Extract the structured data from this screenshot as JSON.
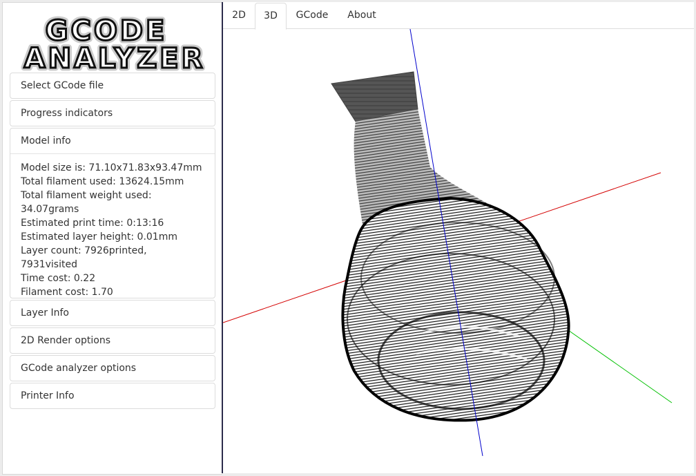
{
  "logo": {
    "line1": "GCODE",
    "line2": "ANALYZER"
  },
  "sidebar": {
    "items": [
      {
        "label": "Select GCode file"
      },
      {
        "label": "Progress indicators"
      },
      {
        "label": "Model info"
      },
      {
        "label": "Layer Info"
      },
      {
        "label": "2D Render options"
      },
      {
        "label": "GCode analyzer options"
      },
      {
        "label": "Printer Info"
      }
    ],
    "model_info": {
      "lines": [
        "Model size is: 71.10x71.83x93.47mm",
        "Total filament used: 13624.15mm",
        "Total filament weight used:",
        "34.07grams",
        "Estimated print time: 0:13:16",
        "Estimated layer height: 0.01mm",
        "Layer count: 7926printed, 7931visited",
        "Time cost: 0.22",
        "Filament cost: 1.70"
      ]
    }
  },
  "tabs": [
    {
      "label": "2D"
    },
    {
      "label": "3D"
    },
    {
      "label": "GCode"
    },
    {
      "label": "About"
    }
  ],
  "active_tab": "3D",
  "viewport": {
    "axis_colors": {
      "x": "#d40000",
      "y": "#00c000",
      "z": "#0000cc"
    },
    "model_color": "#111111"
  }
}
